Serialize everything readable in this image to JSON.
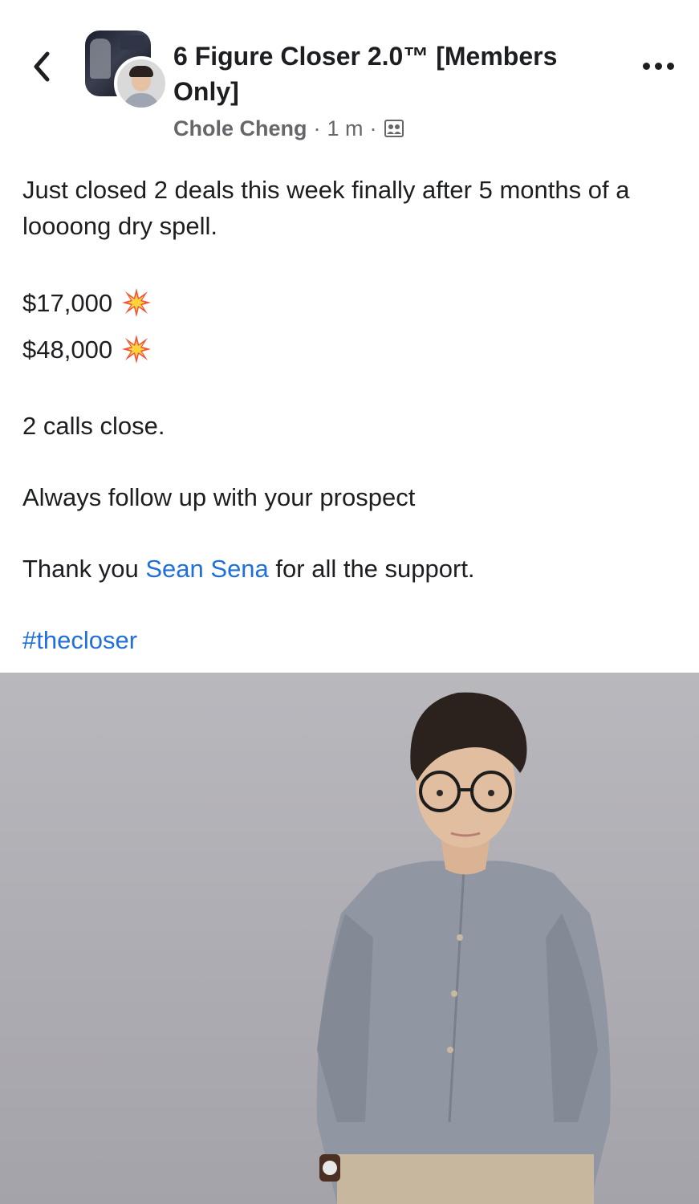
{
  "header": {
    "group_name": "6 Figure Closer 2.0™ [Members Only]",
    "author": "Chole Cheng",
    "separator": "·",
    "time": "1 m",
    "privacy_icon": "members-group-icon"
  },
  "post": {
    "intro": "Just closed 2 deals this week finally after 5 months of a loooong dry spell.",
    "amounts": [
      "$17,000",
      "$48,000"
    ],
    "amount_emoji": "collision-icon",
    "calls": "2 calls close.",
    "advice": "Always follow up with your prospect",
    "thanks_prefix": "Thank you ",
    "mention": "Sean Sena",
    "thanks_suffix": " for all the support.",
    "hashtag": "#thecloser"
  },
  "colors": {
    "link": "#216fdb",
    "meta_text": "#65676b",
    "text": "#1c1e21",
    "photo_background": "#aeadb3"
  }
}
